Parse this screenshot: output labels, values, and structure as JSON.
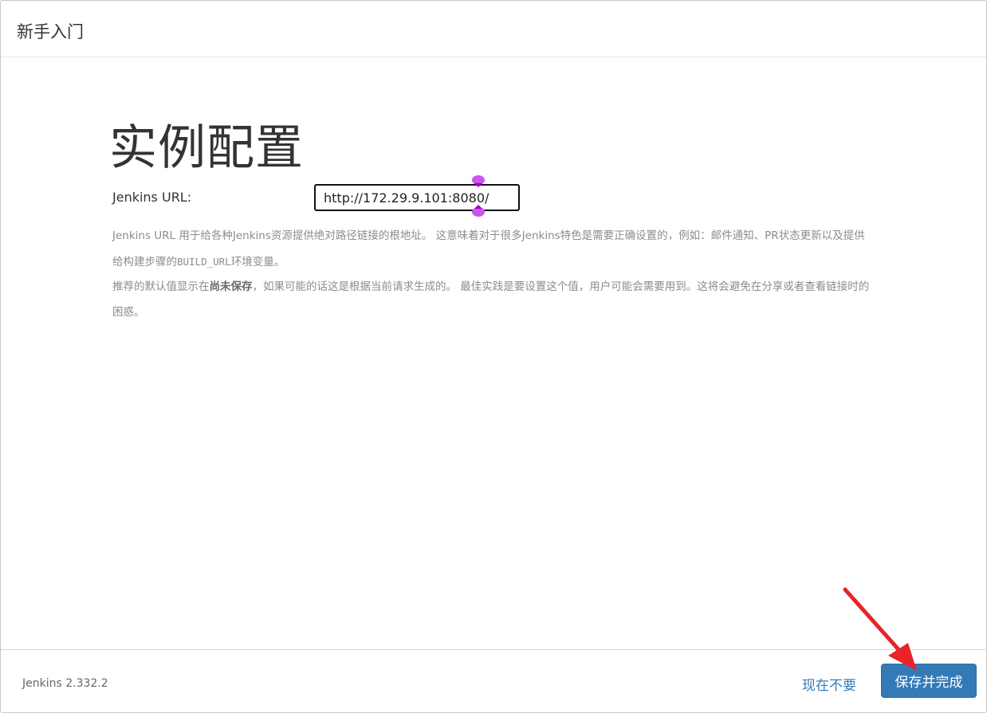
{
  "header": {
    "title": "新手入门"
  },
  "main": {
    "title": "实例配置",
    "url_label": "Jenkins URL:",
    "url_value": "http://172.29.9.101:8080/",
    "help": {
      "p1_a": "Jenkins URL 用于给各种Jenkins资源提供绝对路径链接的根地址。 这意味着对于很多Jenkins特色是需要正确设置的，例如：邮件通知、PR状态更新以及提供给构建步骤的",
      "p1_code": "BUILD_URL",
      "p1_b": "环境变量。",
      "p2_a": "推荐的默认值显示在",
      "p2_bold": "尚未保存",
      "p2_b": "，如果可能的话这是根据当前请求生成的。 最佳实践是要设置这个值，用户可能会需要用到。这将会避免在分享或者查看链接时的困惑。"
    }
  },
  "footer": {
    "version": "Jenkins 2.332.2",
    "skip_label": "现在不要",
    "save_label": "保存并完成"
  },
  "colors": {
    "primary": "#337ab7",
    "annotation_arrow": "#e8232a",
    "text_cursor_handle": "#cc55ee"
  }
}
